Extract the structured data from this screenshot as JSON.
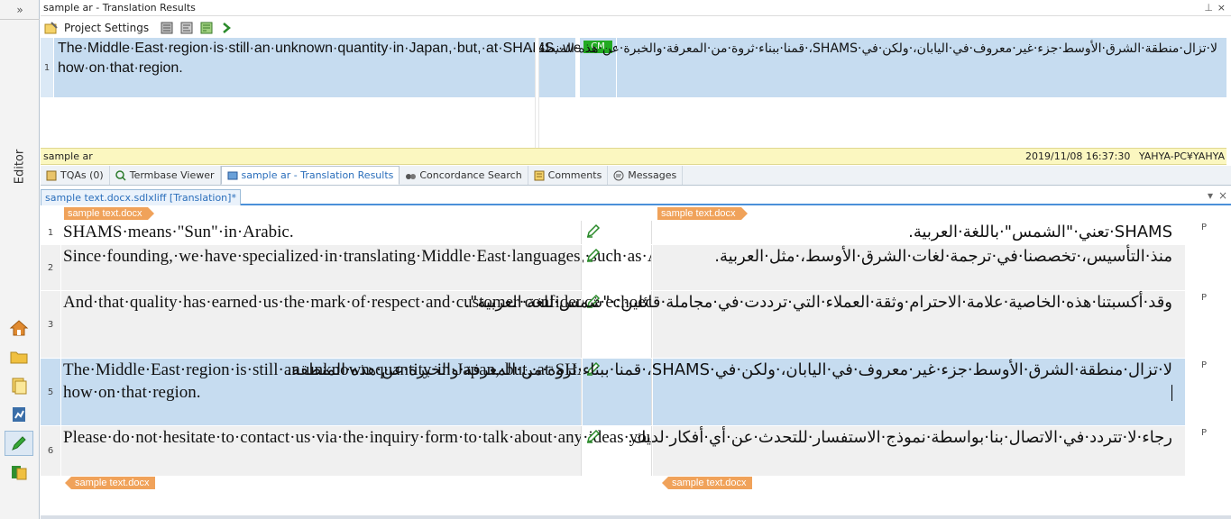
{
  "rail": {
    "label": "Editor",
    "top_toggle": "»"
  },
  "translation_results": {
    "title": "sample ar - Translation Results",
    "pin": "⊥",
    "close": "×",
    "project_settings": "Project Settings",
    "row_number": "1",
    "source": "The·Middle·East·region·is·still·an·unknown·quantity·in·Japan,·but,·at·SHAMS,·we·have·built·up·a·wealth·of·knowledge·and·know-how·on·that·region.",
    "badge": "CM",
    "target": "لا·تزال·منطقة·الشرق·الأوسط·جزء·غير·معروف·في·اليابان،·ولكن·في·SHAMS،·قمنا·ببناء·ثروة·من·المعرفة·والخبرة·عن·هذه·المنطقة."
  },
  "status_bar": {
    "name": "sample ar",
    "timestamp": "2019/11/08 16:37:30",
    "user": "YAHYA-PC¥YAHYA"
  },
  "tabs": [
    {
      "label": "TQAs (0)"
    },
    {
      "label": "Termbase Viewer"
    },
    {
      "label": "sample ar - Translation Results"
    },
    {
      "label": "Concordance Search"
    },
    {
      "label": "Comments"
    },
    {
      "label": "Messages"
    }
  ],
  "document_tab": {
    "label": "sample text.docx.sdlxliff [Translation]*",
    "dropdown": "▾",
    "close": "×"
  },
  "editor": {
    "file_tag": "sample text.docx",
    "segments": [
      {
        "num": "1",
        "source": "SHAMS·means·\"Sun\"·in·Arabic.",
        "target": "SHAMS·تعني·\"الشمس\"·باللغة·العربية.",
        "p": "P"
      },
      {
        "num": "2",
        "source": "Since·founding,·we·have·specialized·in·translating·Middle·East·languages,·such·as·Arabic.",
        "target": "منذ·التأسيس،·تخصصنا·في·ترجمة·لغات·الشرق·الأوسط،·مثل·العربية.",
        "p": ""
      },
      {
        "num": "3",
        "source": "And·that·quality·has·earned·us·the·mark·of·respect·and·customer·confidence·echoed·in·the·compliment:·\"SHAMS·for·Arabic\".",
        "target": "وقد·أكسبتنا·هذه·الخاصية·علامة·الاحترام·وثقة·العملاء·التي·ترددت·في·مجاملة·قائلين:·\"شمس·للغة·العربية\".",
        "p": "P"
      },
      {
        "num": "5",
        "source": "The·Middle·East·region·is·still·an·unknown·quantity·in·Japan,·but,·at·SHAMS,·we·have·built·up·a·wealth·of·knowledge·and·know-how·on·that·region.",
        "target": "لا·تزال·منطقة·الشرق·الأوسط·جزء·غير·معروف·في·اليابان،·ولكن·في·SHAMS،·قمنا·ببناء·ثروة·من·المعرفة·والخبرة·عن·هذه·المنطقة.",
        "p": "P"
      },
      {
        "num": "6",
        "source": "Please·do·not·hesitate·to·contact·us·via·the·inquiry·form·to·talk·about·any·ideas·you·have.",
        "target": "رجاء·لا·تتردد·في·الاتصال·بنا·بواسطة·نموذج·الاستفسار·للتحدث·عن·أي·أفكار·لديك.",
        "p": "P"
      }
    ]
  },
  "colors": {
    "highlight": "#c6dcf0",
    "status_bar": "#fbf7c0",
    "tag": "#f0a25a",
    "cm_badge": "#22aa22"
  }
}
